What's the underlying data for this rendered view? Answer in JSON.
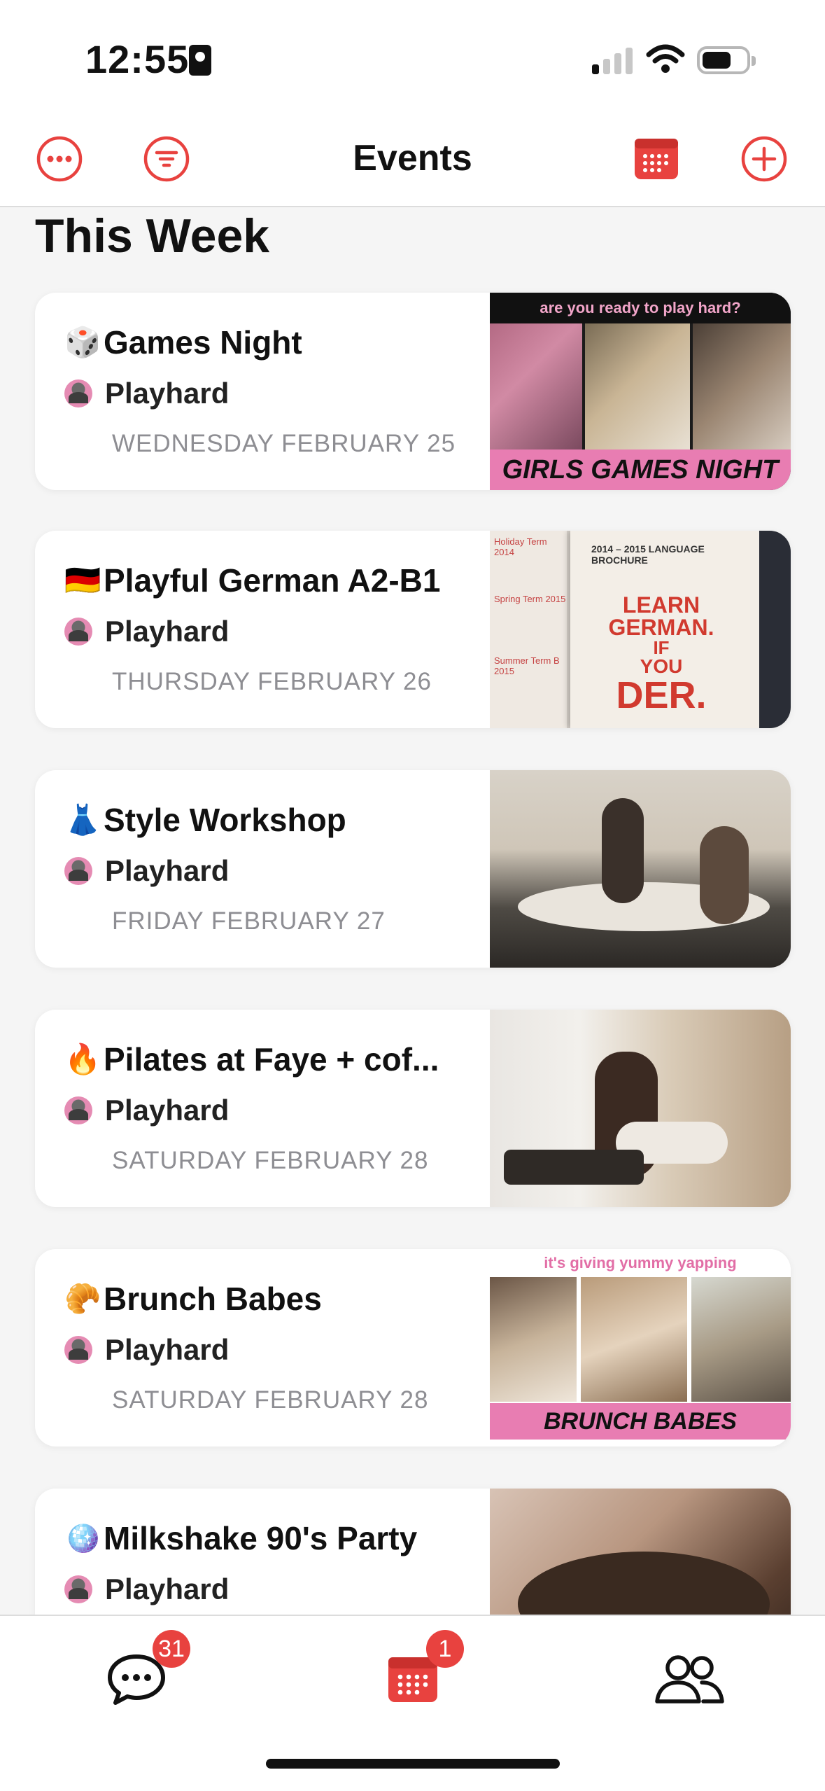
{
  "status_bar": {
    "time": "12:55"
  },
  "nav": {
    "title": "Events",
    "icons": [
      "more-icon",
      "filter-icon",
      "calendar-icon",
      "add-icon"
    ],
    "accent": "#e8423f"
  },
  "section_title": "This Week",
  "events": [
    {
      "emoji": "🎲",
      "title": "Games Night",
      "host": "Playhard",
      "date": "WEDNESDAY FEBRUARY 25",
      "image": {
        "top_text": "are you ready to play hard?",
        "bottom_text": "GIRLS GAMES NIGHT"
      }
    },
    {
      "emoji": "🇩🇪",
      "title": "Playful German A2-B1",
      "host": "Playhard",
      "date": "THURSDAY FEBRUARY 26",
      "image": {
        "brochure_header": "2014 – 2015 LANGUAGE BROCHURE",
        "brochure_lines": [
          "LEARN",
          "GERMAN.",
          "IF",
          "YOU",
          "DER."
        ],
        "side_lines": [
          "Holiday Term 2014",
          "Spring Term 2015",
          "Summer Term B 2015"
        ]
      }
    },
    {
      "emoji": "👗",
      "title": "Style Workshop",
      "host": "Playhard",
      "date": "FRIDAY FEBRUARY 27"
    },
    {
      "emoji": "🔥",
      "title": "Pilates at Faye + cof...",
      "host": "Playhard",
      "date": "SATURDAY FEBRUARY 28"
    },
    {
      "emoji": "🥐",
      "title": "Brunch Babes",
      "host": "Playhard",
      "date": "SATURDAY FEBRUARY 28",
      "image": {
        "top_text": "it's giving yummy yapping",
        "bottom_text": "BRUNCH BABES"
      }
    },
    {
      "emoji": "🪩",
      "title": "Milkshake 90's Party",
      "host": "Playhard",
      "date": ""
    }
  ],
  "tabbar": {
    "chat_badge": "31",
    "events_badge": "1",
    "icons": [
      "chat-icon",
      "calendar-icon",
      "people-icon"
    ]
  }
}
